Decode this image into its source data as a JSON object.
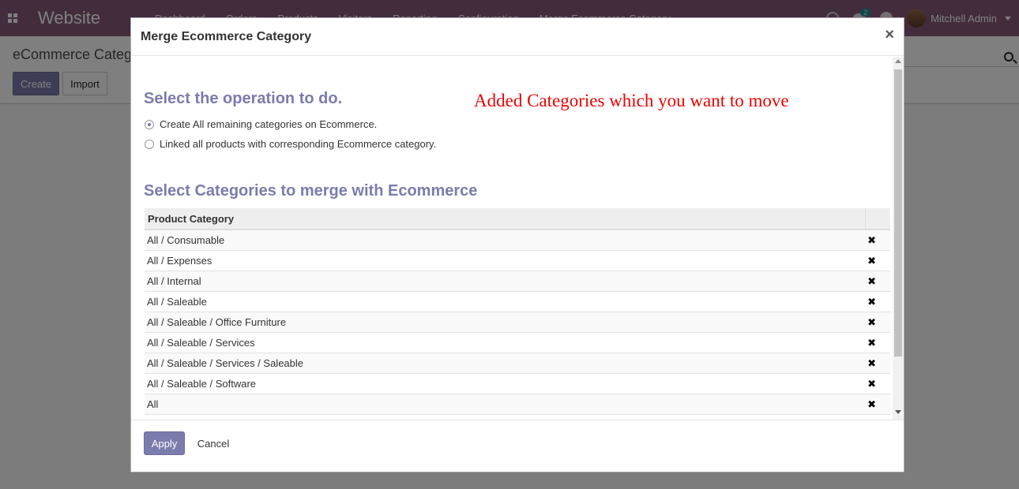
{
  "navbar": {
    "brand": "Website",
    "menu": [
      "Dashboard",
      "Orders",
      "Products",
      "Visitors",
      "Reporting",
      "Configuration",
      "Merge Ecommerce Category"
    ],
    "chat_count": "2",
    "user_name": "Mitchell Admin",
    "color": "#875a7b"
  },
  "control_panel": {
    "breadcrumb": "eCommerce Categ",
    "create_label": "Create",
    "import_label": "Import"
  },
  "modal": {
    "title": "Merge Ecommerce Category",
    "close_symbol": "×",
    "operation_title": "Select the operation to do.",
    "annotation": "Added Categories which you want to move",
    "options": [
      {
        "label": "Create All remaining categories on Ecommerce.",
        "checked": true
      },
      {
        "label": "Linked all products with corresponding Ecommerce category.",
        "checked": false
      }
    ],
    "categories_title": "Select Categories to merge with Ecommerce",
    "table_header": "Product Category",
    "rows": [
      "All / Consumable",
      "All / Expenses",
      "All / Internal",
      "All / Saleable",
      "All / Saleable / Office Furniture",
      "All / Saleable / Services",
      "All / Saleable / Services / Saleable",
      "All / Saleable / Software",
      "All"
    ],
    "delete_symbol": "✖",
    "apply_label": "Apply",
    "cancel_label": "Cancel",
    "accent_color": "#7c7bad"
  }
}
